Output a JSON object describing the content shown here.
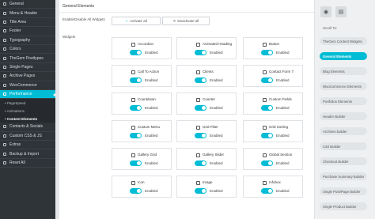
{
  "sidebar": {
    "items_top": [
      {
        "label": "General"
      },
      {
        "label": "Menu & Header"
      },
      {
        "label": "Title Area"
      },
      {
        "label": "Footer"
      },
      {
        "label": "Typography"
      },
      {
        "label": "Colors"
      },
      {
        "label": "TheGem Posttypes"
      },
      {
        "label": "Single Pages"
      },
      {
        "label": "Archive Pages"
      },
      {
        "label": "WooCommerce"
      },
      {
        "label": "Performance"
      }
    ],
    "sub_items": [
      {
        "label": "• PageSpeed"
      },
      {
        "label": "• Animations"
      },
      {
        "label": "• Content Elements"
      }
    ],
    "items_bottom": [
      {
        "label": "Contacts & Socials"
      },
      {
        "label": "Custom CSS & JS"
      },
      {
        "label": "Extras"
      },
      {
        "label": "Backup & Import"
      },
      {
        "label": "Reset All"
      }
    ]
  },
  "main": {
    "title": "General Elements",
    "enable_disable_label": "Enable/Disable All Widgets",
    "activate_all": "Activate all",
    "deactivate_all": "Deactivate all",
    "widgets_label": "Widgets",
    "status_label": "Enabled",
    "widgets": [
      {
        "name": "Accordion"
      },
      {
        "name": "Animated Heading"
      },
      {
        "name": "Button"
      },
      {
        "name": "Call To Action"
      },
      {
        "name": "Clients"
      },
      {
        "name": "Contact Form 7"
      },
      {
        "name": "Countdown"
      },
      {
        "name": "Counter"
      },
      {
        "name": "Custom Fields"
      },
      {
        "name": "Custom Menu"
      },
      {
        "name": "Grid Filter"
      },
      {
        "name": "Grid Sorting"
      },
      {
        "name": "Gallery Grid"
      },
      {
        "name": "Gallery Slider"
      },
      {
        "name": "Global Section"
      },
      {
        "name": "Icon"
      },
      {
        "name": "Image"
      },
      {
        "name": "Infobox"
      }
    ]
  },
  "right_panel": {
    "scroll_to": "Scroll To:",
    "items": [
      {
        "label": "TheGem Content Widgets"
      },
      {
        "label": "General Elements"
      },
      {
        "label": "Blog Elements"
      },
      {
        "label": "WooCommerce Elements"
      },
      {
        "label": "Portfolios Elements"
      },
      {
        "label": "Header Builder"
      },
      {
        "label": "Archives builder"
      },
      {
        "label": "Cart Builder"
      },
      {
        "label": "Checkout Builder"
      },
      {
        "label": "Purchase Summary Builder"
      },
      {
        "label": "Single Post/Page Builder"
      },
      {
        "label": "Single Product Builder"
      }
    ]
  }
}
